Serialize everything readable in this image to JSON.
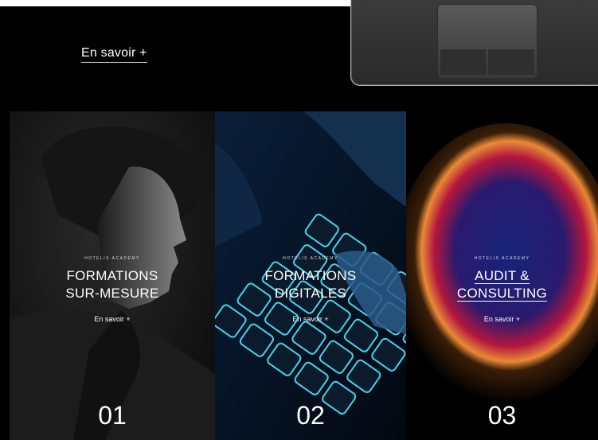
{
  "top_section": {
    "link_label": "En savoir +"
  },
  "cards": [
    {
      "eyebrow": "HOTELIS ACADEMY",
      "title_line1": "FORMATIONS",
      "title_line2": "SUR-MESURE",
      "link": "En savoir +",
      "number": "01"
    },
    {
      "eyebrow": "HOTELIS ACADEMY",
      "title_line1": "FORMATIONS",
      "title_line2": "DIGITALES",
      "link": "En savoir +",
      "number": "02"
    },
    {
      "eyebrow": "HOTELIS ACADEMY",
      "title_line1": "AUDIT &",
      "title_line2": "CONSULTING",
      "link": "En savoir +",
      "number": "03"
    }
  ],
  "colors": {
    "background": "#000000",
    "text": "#ffffff",
    "glow_outer": "#e8a03a",
    "glow_mid": "#c01f3a",
    "glow_inner": "#1c2a78",
    "keyboard_glow": "#3ad0e8"
  }
}
